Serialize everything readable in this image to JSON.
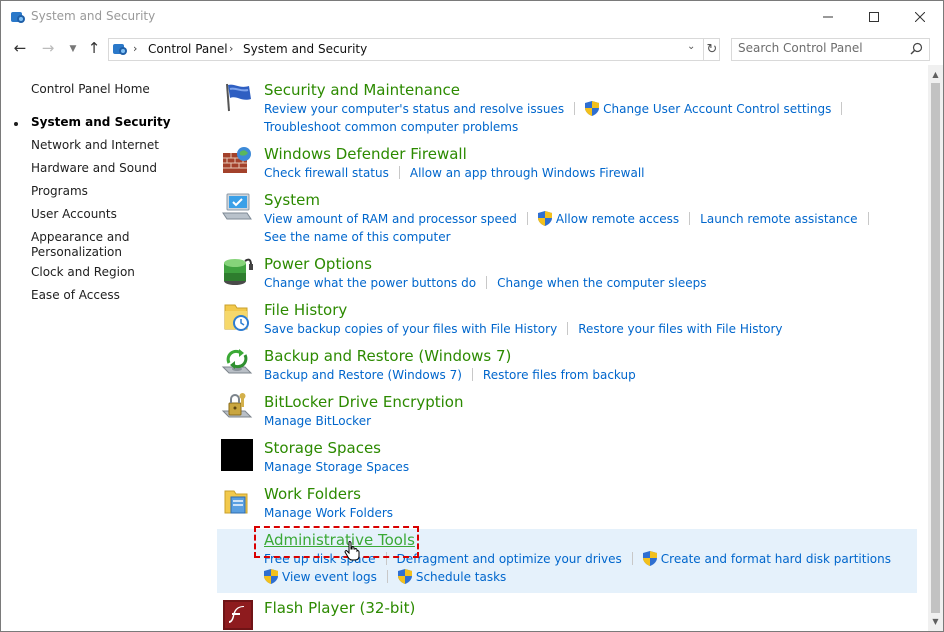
{
  "window": {
    "title": "System and Security"
  },
  "nav": {
    "breadcrumb": [
      "Control Panel",
      "System and Security"
    ],
    "search_placeholder": "Search Control Panel"
  },
  "sidebar": {
    "items": [
      {
        "label": "Control Panel Home"
      },
      {
        "label": "System and Security",
        "active": true
      },
      {
        "label": "Network and Internet"
      },
      {
        "label": "Hardware and Sound"
      },
      {
        "label": "Programs"
      },
      {
        "label": "User Accounts"
      },
      {
        "label": "Appearance and\nPersonalization"
      },
      {
        "label": "Clock and Region"
      },
      {
        "label": "Ease of Access"
      }
    ]
  },
  "categories": {
    "security": {
      "title": "Security and Maintenance",
      "t1": "Review your computer's status and resolve issues",
      "t2": "Change User Account Control settings",
      "t3": "Troubleshoot common computer problems"
    },
    "firewall": {
      "title": "Windows Defender Firewall",
      "t1": "Check firewall status",
      "t2": "Allow an app through Windows Firewall"
    },
    "system": {
      "title": "System",
      "t1": "View amount of RAM and processor speed",
      "t2": "Allow remote access",
      "t3": "Launch remote assistance",
      "t4": "See the name of this computer"
    },
    "power": {
      "title": "Power Options",
      "t1": "Change what the power buttons do",
      "t2": "Change when the computer sleeps"
    },
    "filehistory": {
      "title": "File History",
      "t1": "Save backup copies of your files with File History",
      "t2": "Restore your files with File History"
    },
    "backup": {
      "title": "Backup and Restore (Windows 7)",
      "t1": "Backup and Restore (Windows 7)",
      "t2": "Restore files from backup"
    },
    "bitlocker": {
      "title": "BitLocker Drive Encryption",
      "t1": "Manage BitLocker"
    },
    "storage": {
      "title": "Storage Spaces",
      "t1": "Manage Storage Spaces"
    },
    "workfolders": {
      "title": "Work Folders",
      "t1": "Manage Work Folders"
    },
    "admin": {
      "title": "Administrative Tools",
      "t1": "Free up disk space",
      "t2": "Defragment and optimize your drives",
      "t3": "Create and format hard disk partitions",
      "t4": "View event logs",
      "t5": "Schedule tasks"
    },
    "flash": {
      "title": "Flash Player (32-bit)"
    }
  },
  "colors": {
    "category_title": "#2c8a00",
    "task_link": "#0066cc",
    "hover_highlight": "#e5f1fb",
    "annotation_box": "#d90000"
  }
}
